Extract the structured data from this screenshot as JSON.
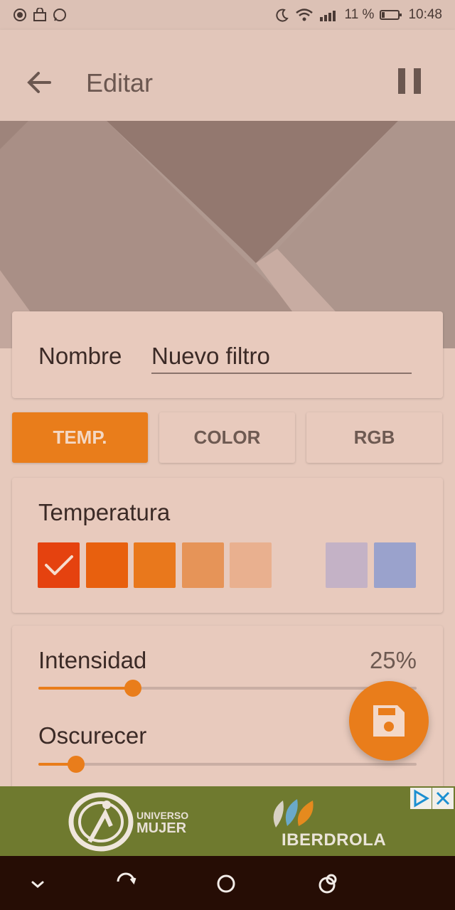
{
  "status_bar": {
    "battery": "11 %",
    "time": "10:48"
  },
  "app_bar": {
    "title": "Editar"
  },
  "name_card": {
    "label": "Nombre",
    "value": "Nuevo filtro"
  },
  "tabs": [
    {
      "label": "TEMP.",
      "active": true
    },
    {
      "label": "COLOR",
      "active": false
    },
    {
      "label": "RGB",
      "active": false
    }
  ],
  "temperature": {
    "title": "Temperatura",
    "swatches": [
      "#e5420f",
      "#e8600e",
      "#e9781c",
      "#e69458",
      "#e9b08f",
      "#c4b2c6",
      "#9aa2cc"
    ],
    "selected_index": 0
  },
  "sliders": [
    {
      "label": "Intensidad",
      "value_text": "25%",
      "value": 0.25
    },
    {
      "label": "Oscurecer",
      "value_text": "",
      "value": 0.1
    }
  ],
  "ad": {
    "brand1_line1": "UNIVERSO",
    "brand1_line2": "MUJER",
    "brand2": "IBERDROLA"
  },
  "colors": {
    "accent": "#e97d1b",
    "background": "#e6c9bc",
    "navbar": "#260d05"
  }
}
